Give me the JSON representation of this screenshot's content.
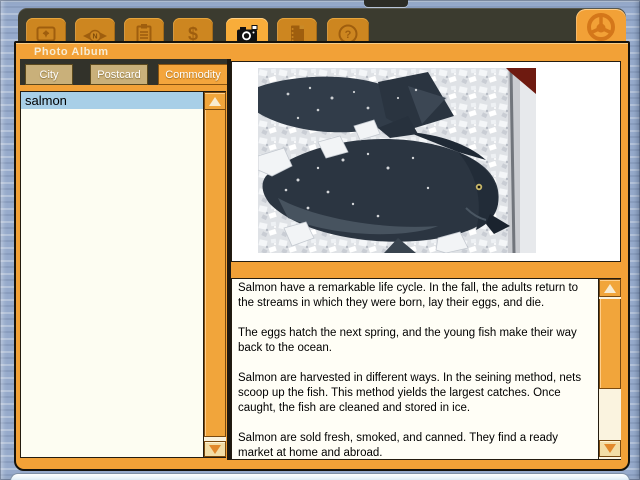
{
  "window": {
    "title": "Photo Album"
  },
  "toolbar": {
    "icons": [
      "money-bill",
      "compass",
      "clipboard",
      "dollar-sign",
      "camera",
      "notebook",
      "help",
      "steering-wheel"
    ],
    "active_icon": "camera",
    "dollar_glyph": "$",
    "help_glyph": "?",
    "compass_letter": "N"
  },
  "tabs": {
    "items": [
      {
        "label": "City"
      },
      {
        "label": "Postcard"
      },
      {
        "label": "Commodity"
      }
    ],
    "active": "Commodity"
  },
  "list": {
    "items": [
      "salmon"
    ],
    "selected": "salmon"
  },
  "photo": {
    "description": "two whole salmon packed in crushed ice in a tray"
  },
  "description": {
    "paragraphs": [
      "Salmon have a remarkable life cycle. In the fall, the adults return to the streams in which they were born, lay their eggs, and die.",
      "The eggs hatch the next spring, and the young fish make their way back to the ocean.",
      "Salmon are harvested in different ways. In the seining method, nets scoop up the fish. This method yields the largest catches. Once caught, the fish are cleaned and stored in ice.",
      "Salmon are sold fresh, smoked, and canned. They find a ready market at home and abroad."
    ]
  },
  "colors": {
    "accent_orange": "#f2a137",
    "toolbar_dark": "#3b3b2f",
    "tab_inactive": "#c9b07a",
    "selection_blue": "#a8cfe7",
    "background_steel_blue": "#96aacb"
  }
}
